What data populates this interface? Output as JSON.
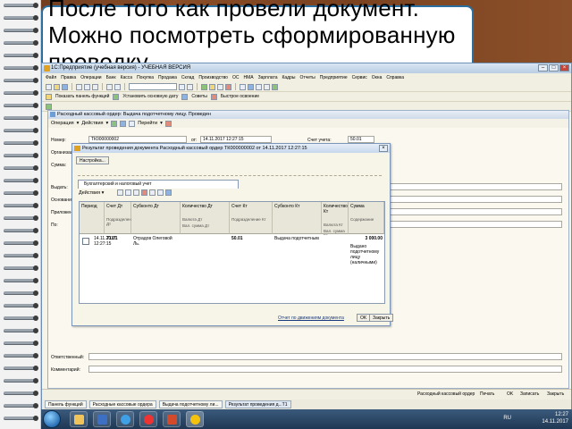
{
  "slide": {
    "title": "После того как провели документ. Можно посмотреть сформированную проводку"
  },
  "app": {
    "title": "1С:Предприятие (учебная версия) - УЧЕБНАЯ ВЕРСИЯ",
    "menu": [
      "Файл",
      "Правка",
      "Операции",
      "Банк",
      "Касса",
      "Покупка",
      "Продажа",
      "Склад",
      "Производство",
      "ОС",
      "НМА",
      "Зарплата",
      "Кадры",
      "Отчеты",
      "Предприятие",
      "Сервис",
      "Окна",
      "Справка"
    ],
    "toolbar2_items": [
      "Показать панель функций",
      "Установить основную дату",
      "Советы",
      "Быстрое освоение"
    ]
  },
  "doc": {
    "title": "Расходный кассовый ордер: Выдача подотчетному лицу. Проведен",
    "toolbar": [
      "Операция",
      "Действия",
      "Перейти"
    ],
    "fields": {
      "number_label": "Номер:",
      "number_value": "ТК000000002",
      "date_label": "от:",
      "date_value": "14.11.2017 12:27:15",
      "account_label": "Счет учета:",
      "account_value": "50.01",
      "org_label": "Организация:",
      "sum_label": "Сумма:",
      "recipient_label": "Выдать:",
      "basis_label": "Основание:",
      "appendix_label": "Приложение:",
      "by_label": "По:",
      "responsible_label": "Ответственный:",
      "comment_label": "Комментарий:"
    }
  },
  "dialog": {
    "title": "Результат проведения документа Расходный кассовый ордер ТК000000002 от 14.11.2017 12:27:15",
    "settings": "Настройка...",
    "accounting_tab": "Бухгалтерский и налоговый учет",
    "actions": "Действия",
    "columns": [
      {
        "title": "Период",
        "sub": "",
        "sub2": ""
      },
      {
        "title": "Счет Дт",
        "sub": "Подразделение Дт",
        "sub2": ""
      },
      {
        "title": "Субконто Дт",
        "sub": "",
        "sub2": ""
      },
      {
        "title": "Количество Дт",
        "sub": "Валюта Дт",
        "sub2": "Вал. сумма Дт"
      },
      {
        "title": "Счет Кт",
        "sub": "Подразделение Кт",
        "sub2": ""
      },
      {
        "title": "Субконто Кт",
        "sub": "",
        "sub2": ""
      },
      {
        "title": "Количество Кт",
        "sub": "Валюта Кт",
        "sub2": "Вал. сумма Кт"
      },
      {
        "title": "Сумма",
        "sub": "Содержание",
        "sub2": ""
      }
    ],
    "row": {
      "period": "14.11.2017 12:27:15",
      "account_dt": "71.01",
      "subconto_dt": "Отрадов Олеговой Ль.",
      "account_kt": "50.01",
      "subconto_kt": "Выдача подотчетным",
      "sum": "3 000.00",
      "content": "Выдано подотчетному лицу (наличными)"
    },
    "movements_link": "Отчет по движениям документа",
    "ok": "OK",
    "close": "Закрыть"
  },
  "status": {
    "left": "Расходный кассовый ордер",
    "right_items": [
      "Печать",
      "OK",
      "Записать",
      "Закрыть"
    ]
  },
  "windows": [
    "Панель функций",
    "Расходные кассовые ордера",
    "Выдача подотчетному ли...",
    "Результат проведения д...Т1"
  ],
  "taskbar": {
    "lang": "RU",
    "time": "12:27",
    "date": "14.11.2017"
  }
}
